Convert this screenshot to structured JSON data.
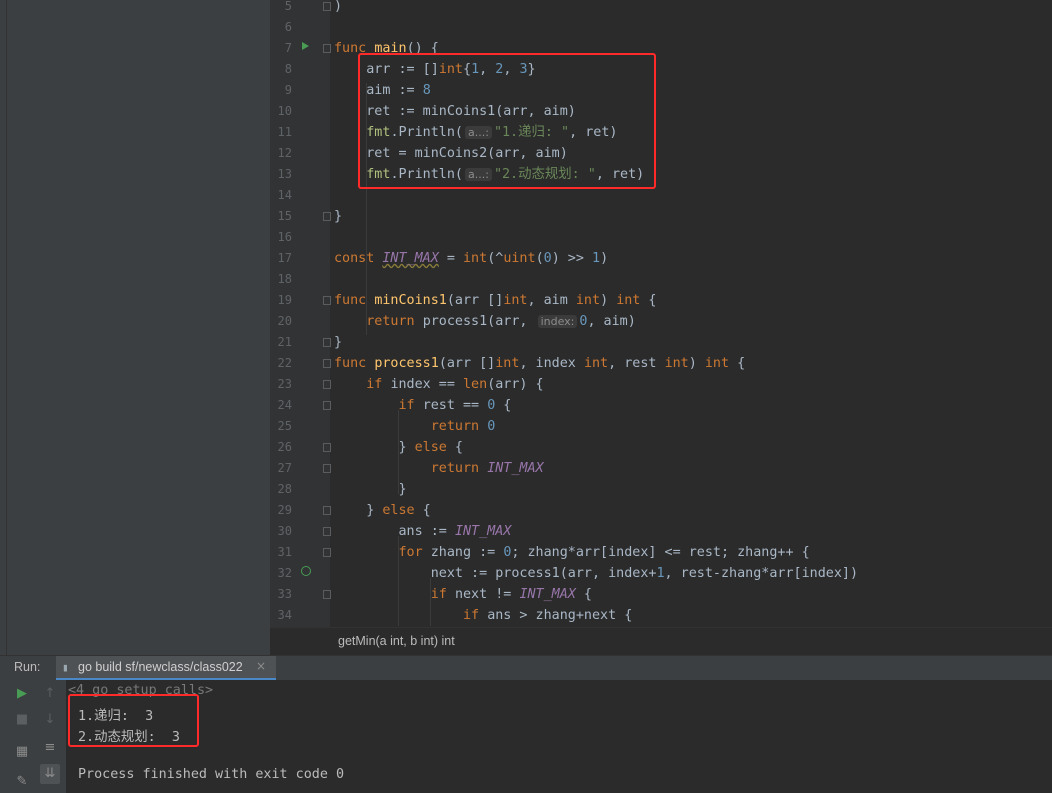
{
  "editor": {
    "lines": [
      {
        "n": "5",
        "tokens": [
          {
            "t": ")"
          }
        ]
      },
      {
        "n": "6",
        "tokens": []
      },
      {
        "n": "7",
        "tokens": [
          {
            "t": "func ",
            "c": "kw"
          },
          {
            "t": "main",
            "c": "fn"
          },
          {
            "t": "() {"
          }
        ]
      },
      {
        "n": "8",
        "tokens": [
          {
            "t": "    arr := []"
          },
          {
            "t": "int",
            "c": "kw"
          },
          {
            "t": "{"
          },
          {
            "t": "1",
            "c": "num"
          },
          {
            "t": ", "
          },
          {
            "t": "2",
            "c": "num"
          },
          {
            "t": ", "
          },
          {
            "t": "3",
            "c": "num"
          },
          {
            "t": "}"
          }
        ]
      },
      {
        "n": "9",
        "tokens": [
          {
            "t": "    aim := "
          },
          {
            "t": "8",
            "c": "num"
          }
        ]
      },
      {
        "n": "10",
        "tokens": [
          {
            "t": "    ret := minCoins1(arr, aim)"
          }
        ]
      },
      {
        "n": "11",
        "tokens": [
          {
            "t": "    "
          },
          {
            "t": "fmt",
            "c": "pkg"
          },
          {
            "t": ".Println("
          },
          {
            "t": "a...:",
            "c": "hint"
          },
          {
            "t": "\"1.递归: \"",
            "c": "str"
          },
          {
            "t": ", ret)"
          }
        ]
      },
      {
        "n": "12",
        "tokens": [
          {
            "t": "    ret = minCoins2(arr, aim)"
          }
        ]
      },
      {
        "n": "13",
        "tokens": [
          {
            "t": "    "
          },
          {
            "t": "fmt",
            "c": "pkg"
          },
          {
            "t": ".Println("
          },
          {
            "t": "a...:",
            "c": "hint"
          },
          {
            "t": "\"2.动态规划: \"",
            "c": "str"
          },
          {
            "t": ", ret)"
          }
        ]
      },
      {
        "n": "14",
        "tokens": []
      },
      {
        "n": "15",
        "tokens": [
          {
            "t": "}"
          }
        ]
      },
      {
        "n": "16",
        "tokens": []
      },
      {
        "n": "17",
        "tokens": [
          {
            "t": "const ",
            "c": "kw"
          },
          {
            "t": "INT_MAX",
            "c": "const underline"
          },
          {
            "t": " = "
          },
          {
            "t": "int",
            "c": "kw"
          },
          {
            "t": "(^"
          },
          {
            "t": "uint",
            "c": "kw"
          },
          {
            "t": "("
          },
          {
            "t": "0",
            "c": "num"
          },
          {
            "t": ") >> "
          },
          {
            "t": "1",
            "c": "num"
          },
          {
            "t": ")"
          }
        ]
      },
      {
        "n": "18",
        "tokens": []
      },
      {
        "n": "19",
        "tokens": [
          {
            "t": "func ",
            "c": "kw"
          },
          {
            "t": "minCoins1",
            "c": "fn"
          },
          {
            "t": "(arr []"
          },
          {
            "t": "int",
            "c": "kw"
          },
          {
            "t": ", aim "
          },
          {
            "t": "int",
            "c": "kw"
          },
          {
            "t": ") "
          },
          {
            "t": "int",
            "c": "kw"
          },
          {
            "t": " {"
          }
        ]
      },
      {
        "n": "20",
        "tokens": [
          {
            "t": "    "
          },
          {
            "t": "return ",
            "c": "kw"
          },
          {
            "t": "process1(arr, "
          },
          {
            "t": "index:",
            "c": "hint"
          },
          {
            "t": "0",
            "c": "num"
          },
          {
            "t": ", aim)"
          }
        ]
      },
      {
        "n": "21",
        "tokens": [
          {
            "t": "}"
          }
        ]
      },
      {
        "n": "22",
        "tokens": [
          {
            "t": "func ",
            "c": "kw"
          },
          {
            "t": "process1",
            "c": "fn"
          },
          {
            "t": "(arr []"
          },
          {
            "t": "int",
            "c": "kw"
          },
          {
            "t": ", index "
          },
          {
            "t": "int",
            "c": "kw"
          },
          {
            "t": ", rest "
          },
          {
            "t": "int",
            "c": "kw"
          },
          {
            "t": ") "
          },
          {
            "t": "int",
            "c": "kw"
          },
          {
            "t": " {"
          }
        ]
      },
      {
        "n": "23",
        "tokens": [
          {
            "t": "    "
          },
          {
            "t": "if ",
            "c": "kw"
          },
          {
            "t": "index == "
          },
          {
            "t": "len",
            "c": "kw"
          },
          {
            "t": "(arr) {"
          }
        ]
      },
      {
        "n": "24",
        "tokens": [
          {
            "t": "        "
          },
          {
            "t": "if ",
            "c": "kw"
          },
          {
            "t": "rest == "
          },
          {
            "t": "0",
            "c": "num"
          },
          {
            "t": " {"
          }
        ]
      },
      {
        "n": "25",
        "tokens": [
          {
            "t": "            "
          },
          {
            "t": "return ",
            "c": "kw"
          },
          {
            "t": "0",
            "c": "num"
          }
        ]
      },
      {
        "n": "26",
        "tokens": [
          {
            "t": "        } "
          },
          {
            "t": "else",
            "c": "kw"
          },
          {
            "t": " {"
          }
        ]
      },
      {
        "n": "27",
        "tokens": [
          {
            "t": "            "
          },
          {
            "t": "return ",
            "c": "kw"
          },
          {
            "t": "INT_MAX",
            "c": "const"
          }
        ]
      },
      {
        "n": "28",
        "tokens": [
          {
            "t": "        }"
          }
        ]
      },
      {
        "n": "29",
        "tokens": [
          {
            "t": "    } "
          },
          {
            "t": "else",
            "c": "kw"
          },
          {
            "t": " {"
          }
        ]
      },
      {
        "n": "30",
        "tokens": [
          {
            "t": "        ans := "
          },
          {
            "t": "INT_MAX",
            "c": "const"
          }
        ]
      },
      {
        "n": "31",
        "tokens": [
          {
            "t": "        "
          },
          {
            "t": "for ",
            "c": "kw"
          },
          {
            "t": "zhang := "
          },
          {
            "t": "0",
            "c": "num"
          },
          {
            "t": "; zhang*arr[index] <= rest; zhang++ {"
          }
        ]
      },
      {
        "n": "32",
        "tokens": [
          {
            "t": "            next := process1(arr, index+"
          },
          {
            "t": "1",
            "c": "num"
          },
          {
            "t": ", rest-zhang*arr[index])"
          }
        ]
      },
      {
        "n": "33",
        "tokens": [
          {
            "t": "            "
          },
          {
            "t": "if ",
            "c": "kw"
          },
          {
            "t": "next != "
          },
          {
            "t": "INT_MAX",
            "c": "const"
          },
          {
            "t": " {"
          }
        ]
      },
      {
        "n": "34",
        "tokens": [
          {
            "t": "                "
          },
          {
            "t": "if ",
            "c": "kw"
          },
          {
            "t": "ans > zhang+next {"
          }
        ]
      }
    ]
  },
  "breadcrumb": {
    "text": "getMin(a int, b int) int"
  },
  "run": {
    "label": "Run:",
    "tab_label": "go build sf/newclass/class022",
    "close": "×",
    "output": [
      "<4 go setup calls>",
      "1.递归:  3",
      "2.动态规划:  3",
      "",
      "Process finished with exit code 0"
    ]
  }
}
